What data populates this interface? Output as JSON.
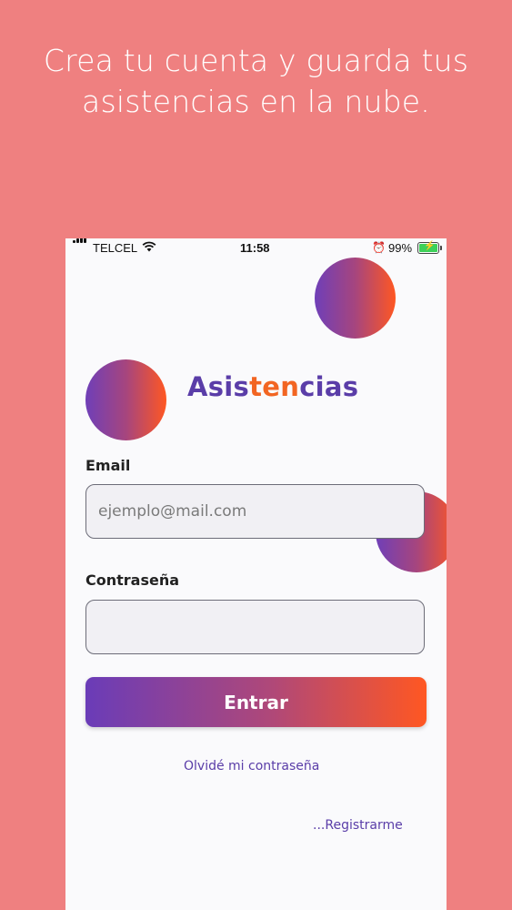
{
  "promo": {
    "line1": "Crea tu cuenta y guarda tus",
    "line2": "asistencias en la nube."
  },
  "status_bar": {
    "carrier": "TELCEL",
    "time": "11:58",
    "battery_percent": "99%",
    "icons": [
      "signal-icon",
      "wifi-icon",
      "alarm-icon",
      "battery-charging-icon"
    ]
  },
  "app": {
    "logo_part1": "Asis",
    "logo_part2": "ten",
    "logo_part3": "cias"
  },
  "form": {
    "email_label": "Email",
    "email_placeholder": "ejemplo@mail.com",
    "email_value": "",
    "password_label": "Contraseña",
    "password_value": "",
    "submit_label": "Entrar",
    "forgot_link": "Olvidé mi contraseña",
    "register_link": "...Registrarme"
  },
  "colors": {
    "background": "#EF8080",
    "brand_purple": "#5A3DA8",
    "brand_orange": "#F26522",
    "gradient_start": "#6A3CB8",
    "gradient_end": "#FF5722"
  }
}
